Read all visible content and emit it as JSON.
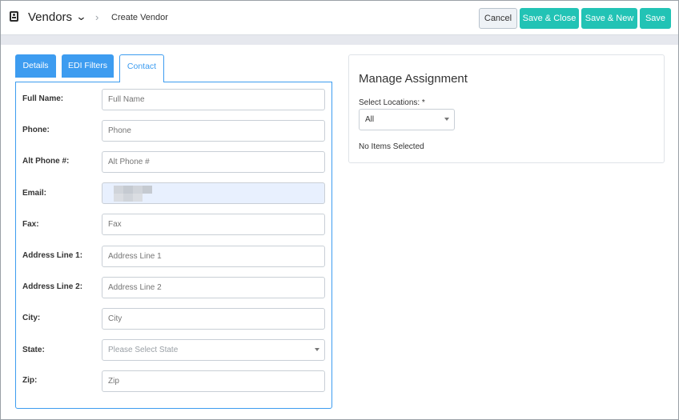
{
  "header": {
    "title": "Vendors",
    "breadcrumb": "Create Vendor",
    "buttons": {
      "cancel": "Cancel",
      "save_close": "Save & Close",
      "save_new": "Save & New",
      "save": "Save"
    }
  },
  "tabs": [
    {
      "label": "Details"
    },
    {
      "label": "EDI Filters"
    },
    {
      "label": "Contact"
    }
  ],
  "form": {
    "fields": [
      {
        "label": "Full Name:",
        "placeholder": "Full Name"
      },
      {
        "label": "Phone:",
        "placeholder": "Phone"
      },
      {
        "label": "Alt Phone #:",
        "placeholder": "Alt Phone #"
      },
      {
        "label": "Email:",
        "placeholder": ""
      },
      {
        "label": "Fax:",
        "placeholder": "Fax"
      },
      {
        "label": "Address Line 1:",
        "placeholder": "Address Line 1"
      },
      {
        "label": "Address Line 2:",
        "placeholder": "Address Line 2"
      },
      {
        "label": "City:",
        "placeholder": "City"
      },
      {
        "label": "State:",
        "placeholder": "Please Select State"
      },
      {
        "label": "Zip:",
        "placeholder": "Zip"
      }
    ]
  },
  "assignment": {
    "title": "Manage Assignment",
    "locations_label": "Select Locations: *",
    "locations_value": "All",
    "empty_text": "No Items Selected"
  }
}
